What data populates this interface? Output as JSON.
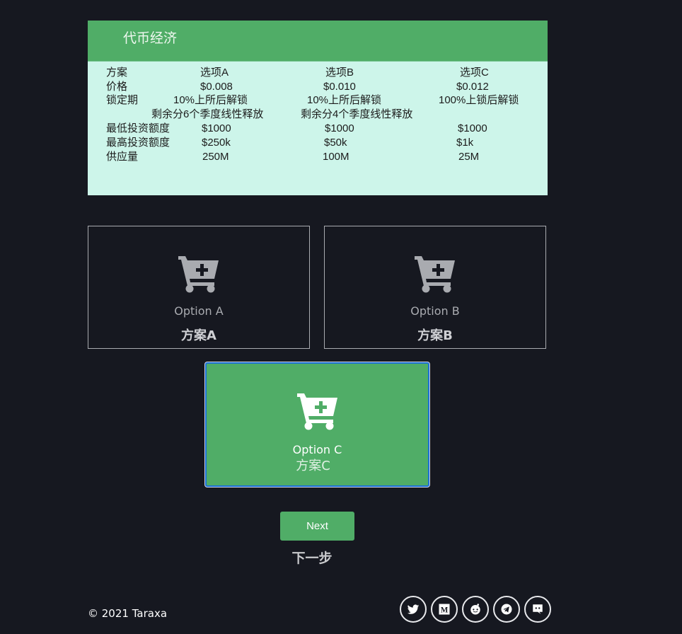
{
  "tokenomics": {
    "title": "代币经济",
    "rows": [
      {
        "label": "方案",
        "a": "选项A",
        "b": "选项B",
        "c": "选项C"
      },
      {
        "label": "价格",
        "a": "$0.008",
        "b": "$0.010",
        "c": "$0.012"
      },
      {
        "label": "锁定期",
        "a": "10%上所后解锁",
        "b": "10%上所后解锁",
        "c": "100%上锁后解锁"
      },
      {
        "label": "",
        "a": "剩余分6个季度线性释放",
        "b": "剩余分4个季度线性释放",
        "c": ""
      },
      {
        "label": "最低投资额度",
        "a": "$1000",
        "b": "$1000",
        "c": "$1000"
      },
      {
        "label": "最高投资额度",
        "a": "$250k",
        "b": "$50k",
        "c": "$1k"
      },
      {
        "label": "供应量",
        "a": "250M",
        "b": "100M",
        "c": "25M"
      }
    ]
  },
  "options": [
    {
      "label_en": "Option A",
      "label_cn": "方案A",
      "selected": false,
      "icon": "cart-plus-icon"
    },
    {
      "label_en": "Option B",
      "label_cn": "方案B",
      "selected": false,
      "icon": "cart-plus-icon"
    },
    {
      "label_en": "Option C",
      "label_cn": "方案C",
      "selected": true,
      "icon": "cart-plus-icon"
    }
  ],
  "next": {
    "label": "Next",
    "label_cn": "下一步"
  },
  "footer": {
    "copyright": "© 2021 Taraxa",
    "socials": [
      {
        "name": "twitter",
        "icon": "twitter-icon"
      },
      {
        "name": "medium",
        "icon": "medium-icon"
      },
      {
        "name": "reddit",
        "icon": "reddit-icon"
      },
      {
        "name": "telegram",
        "icon": "telegram-icon"
      },
      {
        "name": "discord",
        "icon": "discord-icon"
      }
    ]
  },
  "colors": {
    "background": "#161820",
    "accent_green": "#50ad67",
    "table_bg": "#cdf5ea",
    "selected_border": "#1b6fd6"
  }
}
